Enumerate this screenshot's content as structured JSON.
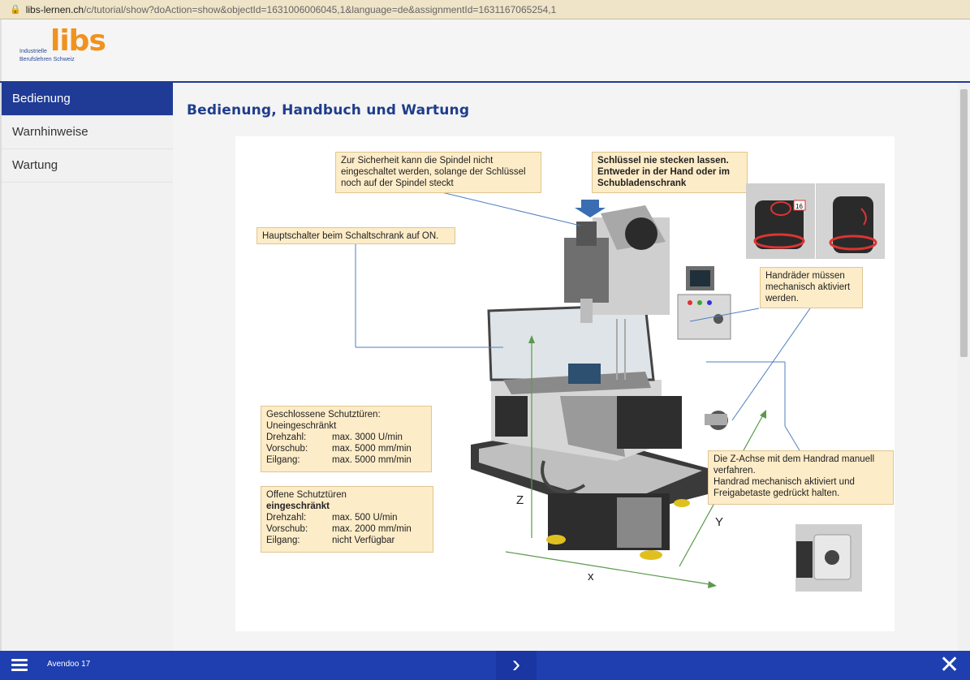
{
  "browser": {
    "url_host": "libs-lernen.ch",
    "url_path": "/c/tutorial/show?doAction=show&objectId=1631006006045,1&language=de&assignmentId=1631167065254,1"
  },
  "logo": {
    "word": "libs",
    "line1": "Industrielle",
    "line2": "Berufslehren Schweiz"
  },
  "sidebar": {
    "items": [
      {
        "label": "Bedienung"
      },
      {
        "label": "Warnhinweise"
      },
      {
        "label": "Wartung"
      }
    ]
  },
  "page": {
    "title": "Bedienung, Handbuch und Wartung"
  },
  "notes": {
    "spindle": "Zur Sicherheit kann die Spindel nicht eingeschaltet werden, solange der Schlüssel noch auf der Spindel steckt",
    "key": "Schlüssel nie stecken lassen. Entweder in der Hand oder im Schubladenschrank",
    "mainswitch": "Hauptschalter beim Schaltschrank auf ON.",
    "handwheels": "Handräder müssen mechanisch aktiviert werden.",
    "zaxis_1": "Die Z-Achse mit dem Handrad manuell verfahren.",
    "zaxis_2": "Handrad mechanisch aktiviert und Freigabetaste gedrückt halten.",
    "closed": {
      "title": "Geschlossene Schutztüren:",
      "subtitle": "Uneingeschränkt",
      "rows": [
        {
          "k": "Drehzahl:",
          "v": "max. 3000 U/min"
        },
        {
          "k": "Vorschub:",
          "v": "max. 5000 mm/min"
        },
        {
          "k": "Eilgang:",
          "v": "max. 5000 mm/min"
        }
      ]
    },
    "open": {
      "title": "Offene Schutztüren",
      "subtitle": "eingeschränkt",
      "rows": [
        {
          "k": "Drehzahl:",
          "v": "max. 500 U/min"
        },
        {
          "k": "Vorschub:",
          "v": "max. 2000 mm/min"
        },
        {
          "k": "Eilgang:",
          "v": "nicht Verfügbar"
        }
      ]
    }
  },
  "axes": {
    "z": "Z",
    "y": "Y",
    "x": "x"
  },
  "photo_label": "16",
  "footer": {
    "text": "Avendoo 17",
    "next_icon": "chevron-right-icon",
    "close_icon": "close-icon"
  },
  "colors": {
    "primary": "#1f3b95",
    "footer": "#1f3fb0",
    "accent": "#f0921e",
    "note_bg": "#fdecc8"
  }
}
